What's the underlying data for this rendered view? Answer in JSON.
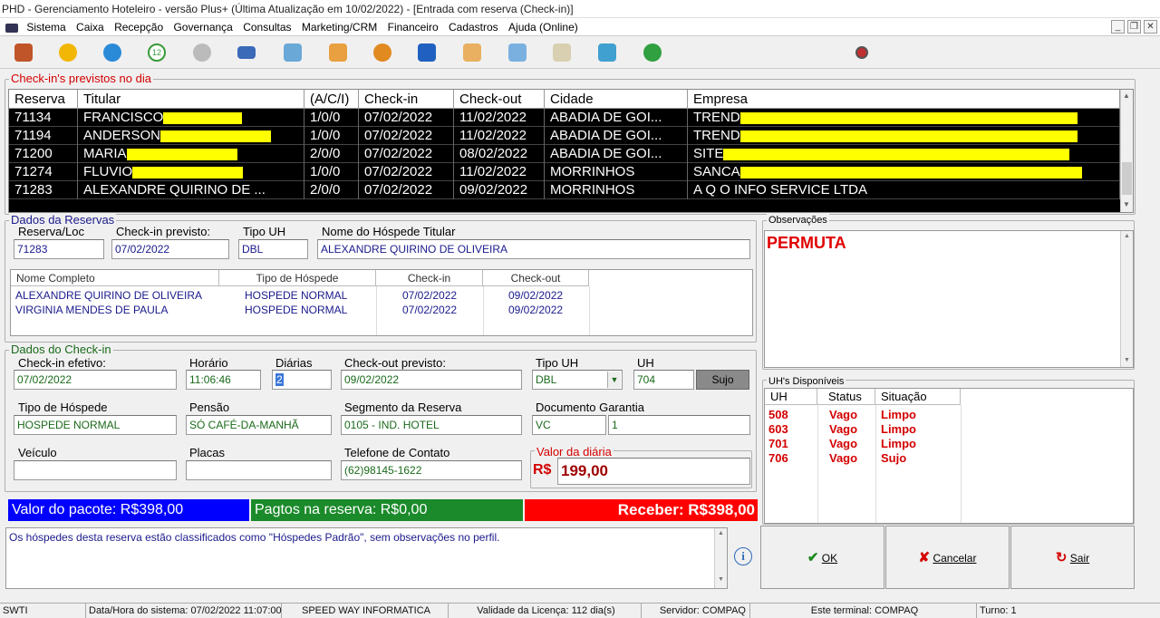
{
  "window": {
    "title": "PHD - Gerenciamento Hoteleiro - versão Plus+    (Última Atualização em 10/02/2022) - [Entrada com reserva (Check-in)]"
  },
  "menu": [
    "Sistema",
    "Caixa",
    "Recepção",
    "Governança",
    "Consultas",
    "Marketing/CRM",
    "Financeiro",
    "Cadastros",
    "Ajuda (Online)"
  ],
  "toolbar_icons": [
    "exit-icon",
    "lock-icon",
    "chat-icon",
    "calendar-12-icon",
    "compass-icon",
    "card-icon",
    "bed-icon",
    "guests-icon",
    "group-icon",
    "running-icon",
    "staff-icon",
    "report-icon",
    "document-icon",
    "grid-icon",
    "chart-icon",
    "record-icon"
  ],
  "checkins": {
    "title": "Check-in's previstos no dia",
    "headers": [
      "Reserva",
      "Titular",
      "(A/C/I)",
      "Check-in",
      "Check-out",
      "Cidade",
      "Empresa"
    ],
    "rows": [
      {
        "reserva": "71134",
        "titular": "FRANCISCO",
        "aci": "1/0/0",
        "checkin": "07/02/2022",
        "checkout": "11/02/2022",
        "cidade": "ABADIA DE GOI...",
        "empresa": "TREND"
      },
      {
        "reserva": "71194",
        "titular": "ANDERSON",
        "aci": "1/0/0",
        "checkin": "07/02/2022",
        "checkout": "11/02/2022",
        "cidade": "ABADIA DE GOI...",
        "empresa": "TREND"
      },
      {
        "reserva": "71200",
        "titular": "MARIA",
        "aci": "2/0/0",
        "checkin": "07/02/2022",
        "checkout": "08/02/2022",
        "cidade": "ABADIA DE GOI...",
        "empresa": "SITE"
      },
      {
        "reserva": "71274",
        "titular": "FLUVIO",
        "aci": "1/0/0",
        "checkin": "07/02/2022",
        "checkout": "11/02/2022",
        "cidade": "MORRINHOS",
        "empresa": "SANCA"
      },
      {
        "reserva": "71283",
        "titular": "ALEXANDRE QUIRINO DE ...",
        "aci": "2/0/0",
        "checkin": "07/02/2022",
        "checkout": "09/02/2022",
        "cidade": "MORRINHOS",
        "empresa": "A Q O INFO SERVICE LTDA"
      }
    ]
  },
  "reserva": {
    "title": "Dados da Reservas",
    "reserva_loc_label": "Reserva/Loc",
    "reserva_loc": "71283",
    "checkin_prev_label": "Check-in previsto:",
    "checkin_prev": "07/02/2022",
    "tipo_uh_label": "Tipo UH",
    "tipo_uh": "DBL",
    "hospede_label": "Nome do Hóspede Titular",
    "hospede": "ALEXANDRE QUIRINO DE OLIVEIRA",
    "guest_headers": [
      "Nome Completo",
      "Tipo de Hóspede",
      "Check-in",
      "Check-out"
    ],
    "guests": [
      {
        "nome": "ALEXANDRE QUIRINO DE OLIVEIRA",
        "tipo": "HOSPEDE NORMAL",
        "checkin": "07/02/2022",
        "checkout": "09/02/2022"
      },
      {
        "nome": "VIRGINIA MENDES DE PAULA",
        "tipo": "HOSPEDE NORMAL",
        "checkin": "07/02/2022",
        "checkout": "09/02/2022"
      }
    ]
  },
  "checkin": {
    "title": "Dados do Check-in",
    "efetivo_label": "Check-in efetivo:",
    "efetivo": "07/02/2022",
    "horario_label": "Horário",
    "horario": "11:06:46",
    "diarias_label": "Diárias",
    "diarias": "2",
    "checkout_prev_label": "Check-out previsto:",
    "checkout_prev": "09/02/2022",
    "tipo_uh_label": "Tipo UH",
    "tipo_uh": "DBL",
    "uh_label": "UH",
    "uh": "704",
    "uh_status": "Sujo",
    "tipo_hospede_label": "Tipo de Hóspede",
    "tipo_hospede": "HOSPEDE NORMAL",
    "pensao_label": "Pensão",
    "pensao": "SÓ CAFÉ-DA-MANHÃ",
    "segmento_label": "Segmento da Reserva",
    "segmento": "0105 - IND. HOTEL",
    "documento_label": "Documento Garantia",
    "documento_tipo": "VC",
    "documento_num": "1",
    "veiculo_label": "Veículo",
    "veiculo": "",
    "placas_label": "Placas",
    "placas": "",
    "telefone_label": "Telefone de Contato",
    "telefone": "(62)98145-1622",
    "valor_label": "Valor da diária",
    "currency": "R$",
    "valor": "199,00"
  },
  "summary": {
    "pacote": "Valor do pacote: R$398,00",
    "pagtos": "Pagtos na reserva: R$0,00",
    "receber": "Receber: R$398,00"
  },
  "message": "Os hóspedes desta reserva estão classificados como \"Hóspedes Padrão\", sem observações no perfil.",
  "observacoes": {
    "title": "Observações",
    "text": "PERMUTA"
  },
  "uhs": {
    "title": "UH's Disponíveis",
    "headers": [
      "UH",
      "Status",
      "Situação"
    ],
    "rows": [
      {
        "uh": "508",
        "status": "Vago",
        "situacao": "Limpo"
      },
      {
        "uh": "603",
        "status": "Vago",
        "situacao": "Limpo"
      },
      {
        "uh": "701",
        "status": "Vago",
        "situacao": "Limpo"
      },
      {
        "uh": "706",
        "status": "Vago",
        "situacao": "Sujo"
      }
    ]
  },
  "buttons": {
    "ok": "OK",
    "cancelar": "Cancelar",
    "sair": "Sair"
  },
  "status": [
    "SWTI",
    "Data/Hora do sistema: 07/02/2022 11:07:00",
    "SPEED WAY INFORMATICA",
    "Validade da Licença: 112 dia(s)",
    "Servidor: COMPAQ",
    "Este terminal: COMPAQ",
    "Turno: 1"
  ]
}
